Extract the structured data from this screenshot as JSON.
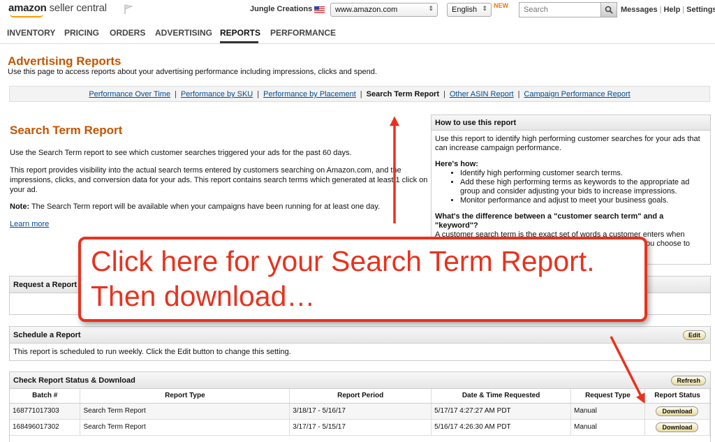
{
  "topbar": {
    "logo_brand": "amazon",
    "logo_product": "seller central",
    "merchant_name": "Jungle Creations",
    "marketplace": "www.amazon.com",
    "language": "English",
    "new_badge": "NEW",
    "search_placeholder": "Search",
    "links": [
      "Messages",
      "Help",
      "Settings"
    ]
  },
  "nav": {
    "items": [
      "INVENTORY",
      "PRICING",
      "ORDERS",
      "ADVERTISING",
      "REPORTS",
      "PERFORMANCE"
    ],
    "active": "REPORTS"
  },
  "page": {
    "title": "Advertising Reports",
    "subtitle": "Use this page to access reports about your advertising performance including impressions, clicks and spend."
  },
  "subnav": {
    "items": [
      "Performance Over Time",
      "Performance by SKU",
      "Performance by Placement",
      "Search Term Report",
      "Other ASIN Report",
      "Campaign Performance Report"
    ],
    "current": "Search Term Report"
  },
  "report": {
    "title": "Search Term Report",
    "para1": "Use the Search Term report to see which customer searches triggered your ads for the past 60 days.",
    "para2": "This report provides visibility into the actual search terms entered by customers searching on Amazon.com, and the impressions, clicks, and conversion data for your ads. This report contains search terms which generated at least 1 click on your ad.",
    "note_label": "Note:",
    "note_text": " The Search Term report will be available when your campaigns have been running for at least one day.",
    "learn_more": "Learn more"
  },
  "howto": {
    "title": "How to use this report",
    "intro": "Use this report to identify high performing customer searches for your ads that can increase campaign performance.",
    "heres_how": "Here's how:",
    "steps": [
      "Identify high performing customer search terms.",
      "Add these high performing terms as keywords to the appropriate ad group and consider adjusting your bids to increase impressions.",
      "Monitor performance and adjust to meet your business goals."
    ],
    "question": "What's the difference between a \"customer search term\" and a \"keyword\"?",
    "answer": "A customer search term is the exact set of words a customer enters when searching on Amazon. A keyword is the word or set of words you choose to show your ads to customers."
  },
  "request": {
    "title": "Request a Report"
  },
  "schedule": {
    "title": "Schedule a Report",
    "edit_label": "Edit",
    "text": "This report is scheduled to run weekly. Click the Edit button to change this setting."
  },
  "status": {
    "title": "Check Report Status & Download",
    "refresh_label": "Refresh",
    "columns": [
      "Batch #",
      "Report Type",
      "Report Period",
      "Date & Time Requested",
      "Request Type",
      "Report Status"
    ],
    "rows": [
      {
        "batch": "168771017303",
        "type": "Search Term Report",
        "period": "3/18/17 - 5/16/17",
        "requested": "5/17/17 4:27:27 AM PDT",
        "request_type": "Manual",
        "action": "Download"
      },
      {
        "batch": "168496017302",
        "type": "Search Term Report",
        "period": "3/17/17 - 5/15/17",
        "requested": "5/16/17 4:26:30 AM PDT",
        "request_type": "Manual",
        "action": "Download"
      }
    ]
  },
  "callout": {
    "line1": "Click here for your Search Term Report.",
    "line2": "Then download…"
  },
  "colors": {
    "accent_orange": "#c45500",
    "link_blue": "#004b91",
    "annotation_red": "#e8321e"
  }
}
